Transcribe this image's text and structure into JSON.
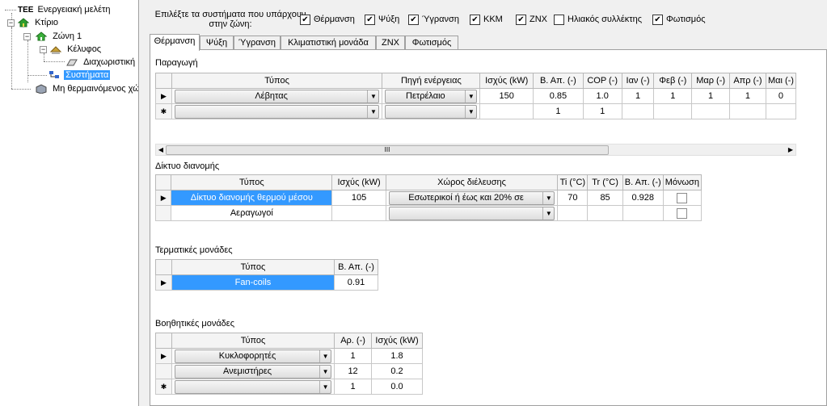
{
  "tree": {
    "root": "Ενεργειακή μελέτη",
    "root_prefix": "TEE",
    "building": "Κτίριο",
    "zone": "Ζώνη 1",
    "shell": "Κέλυφος",
    "partition": "Διαχωριστική",
    "systems": "Συστήματα",
    "unheated": "Μη θερμαινόμενος χώ"
  },
  "systems_question": "Επιλέξτε τα συστήματα που υπάρχουν στην ζώνη:",
  "system_checks": [
    {
      "label": "Θέρμανση",
      "checked": true
    },
    {
      "label": "Ψύξη",
      "checked": true
    },
    {
      "label": "Ύγρανση",
      "checked": true
    },
    {
      "label": "ΚΚΜ",
      "checked": true
    },
    {
      "label": "ΖΝΧ",
      "checked": true
    },
    {
      "label": "Ηλιακός συλλέκτης",
      "checked": false
    },
    {
      "label": "Φωτισμός",
      "checked": true
    }
  ],
  "tabs": [
    "Θέρμανση",
    "Ψύξη",
    "Ύγρανση",
    "Κλιματιστική μονάδα",
    "ΖΝΧ",
    "Φωτισμός"
  ],
  "production": {
    "title": "Παραγωγή",
    "headers": [
      "Τύπος",
      "Πηγή ενέργειας",
      "Ισχύς (kW)",
      "Β. Απ. (-)",
      "COP (-)",
      "Ιαν (-)",
      "Φεβ (-)",
      "Μαρ (-)",
      "Απρ (-)",
      "Μαι (-)"
    ],
    "rows": [
      {
        "marker": "▶",
        "type": "Λέβητας",
        "source": "Πετρέλαιο",
        "power": "150",
        "eff": "0.85",
        "cop": "1.0",
        "jan": "1",
        "feb": "1",
        "mar": "1",
        "apr": "1",
        "may": "0"
      },
      {
        "marker": "✱",
        "type": "",
        "source": "",
        "power": "",
        "eff": "1",
        "cop": "1",
        "jan": "",
        "feb": "",
        "mar": "",
        "apr": "",
        "may": ""
      }
    ]
  },
  "scroll_thumb_label": "III",
  "distribution": {
    "title": "Δίκτυο διανομής",
    "headers": [
      "Τύπος",
      "Ισχύς (kW)",
      "Χώρος διέλευσης",
      "Ti (°C)",
      "Tr (°C)",
      "Β. Απ. (-)",
      "Μόνωση"
    ],
    "rows": [
      {
        "marker": "▶",
        "type": "Δίκτυο διανομής θερμού μέσου",
        "power": "105",
        "space": "Εσωτερικοί  ή έως και 20% σε",
        "ti": "70",
        "tr": "85",
        "eff": "0.928",
        "insulated": false
      },
      {
        "marker": "",
        "type": "Αεραγωγοί",
        "power": "",
        "space": "",
        "ti": "",
        "tr": "",
        "eff": "",
        "insulated": false
      }
    ]
  },
  "terminal": {
    "title": "Τερματικές μονάδες",
    "headers": [
      "Τύπος",
      "Β. Απ. (-)"
    ],
    "rows": [
      {
        "marker": "▶",
        "type": "Fan-coils",
        "eff": "0.91"
      }
    ]
  },
  "auxiliary": {
    "title": "Βοηθητικές μονάδες",
    "headers": [
      "Τύπος",
      "Αρ. (-)",
      "Ισχύς (kW)"
    ],
    "rows": [
      {
        "marker": "▶",
        "type": "Κυκλοφορητές",
        "count": "1",
        "power": "1.8"
      },
      {
        "marker": "",
        "type": "Ανεμιστήρες",
        "count": "12",
        "power": "0.2"
      },
      {
        "marker": "✱",
        "type": "",
        "count": "1",
        "power": "0.0"
      }
    ]
  },
  "colors": {
    "selection": "#3399ff",
    "panel_bg": "#ffffff",
    "window_bg": "#f0f0f0"
  }
}
